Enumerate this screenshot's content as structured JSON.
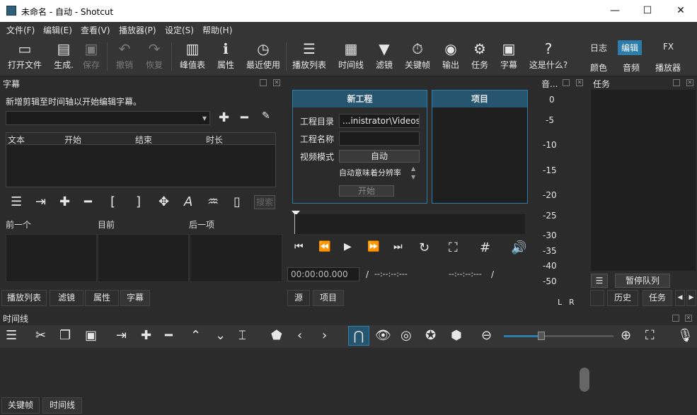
{
  "window": {
    "title": "未命名 - 自动 - Shotcut",
    "minimize": "—",
    "maximize": "☐",
    "close": "✕"
  },
  "menu": [
    "文件(F)",
    "编辑(E)",
    "查看(V)",
    "播放器(P)",
    "设定(S)",
    "帮助(H)"
  ],
  "toolbar": {
    "open_file": "打开文件",
    "generate": "生成.",
    "save": "保存",
    "undo": "撤销",
    "redo": "恢复",
    "peak_meter": "峰值表",
    "properties": "属性",
    "recent": "最近使用",
    "playlist": "播放列表",
    "timeline": "时间线",
    "filters": "滤镜",
    "keyframes": "关键帧",
    "export": "输出",
    "jobs": "任务",
    "subtitles": "字幕",
    "whats_this": "这是什么?",
    "layouts": {
      "log": "日志",
      "edit": "编辑",
      "fx": "FX",
      "color": "颜色",
      "audio": "音频",
      "player": "播放器"
    }
  },
  "subtitles_panel": {
    "title": "字幕",
    "hint": "新增剪辑至时间轴以开始编辑字幕。",
    "columns": [
      "文本",
      "开始",
      "结束",
      "时长"
    ],
    "nav_columns": [
      "前一个",
      "目前",
      "后一项"
    ],
    "search_label": "搜索"
  },
  "left_tabs": [
    "播放列表",
    "滤镜",
    "属性",
    "字幕"
  ],
  "new_project": {
    "title": "新工程",
    "dir_label": "工程目录",
    "dir_value": "...inistrator\\Videos",
    "name_label": "工程名称",
    "name_value": "",
    "video_mode_label": "视频模式",
    "video_mode_value": "自动",
    "auto_note": "自动意味着分辨率",
    "start_button": "开始"
  },
  "projects_panel": {
    "title": "项目"
  },
  "player": {
    "timecode": "00:00:00.000",
    "separator": "/",
    "in_out": "--:--:--:---",
    "duration": "--:--:--:---",
    "sep2": "/",
    "tabs": [
      "源",
      "项目"
    ]
  },
  "audio_meter": {
    "title": "音...",
    "scale": [
      "0",
      "-5",
      "-10",
      "-15",
      "-20",
      "-25",
      "-30",
      "-35",
      "-40",
      "-50"
    ],
    "left": "L",
    "right": "R"
  },
  "jobs_panel": {
    "title": "任务",
    "pause_button": "暂停队列",
    "tabs": [
      "历史",
      "任务"
    ]
  },
  "timeline_panel": {
    "title": "时间线"
  },
  "bottom_tabs": [
    "关键帧",
    "时间线"
  ]
}
